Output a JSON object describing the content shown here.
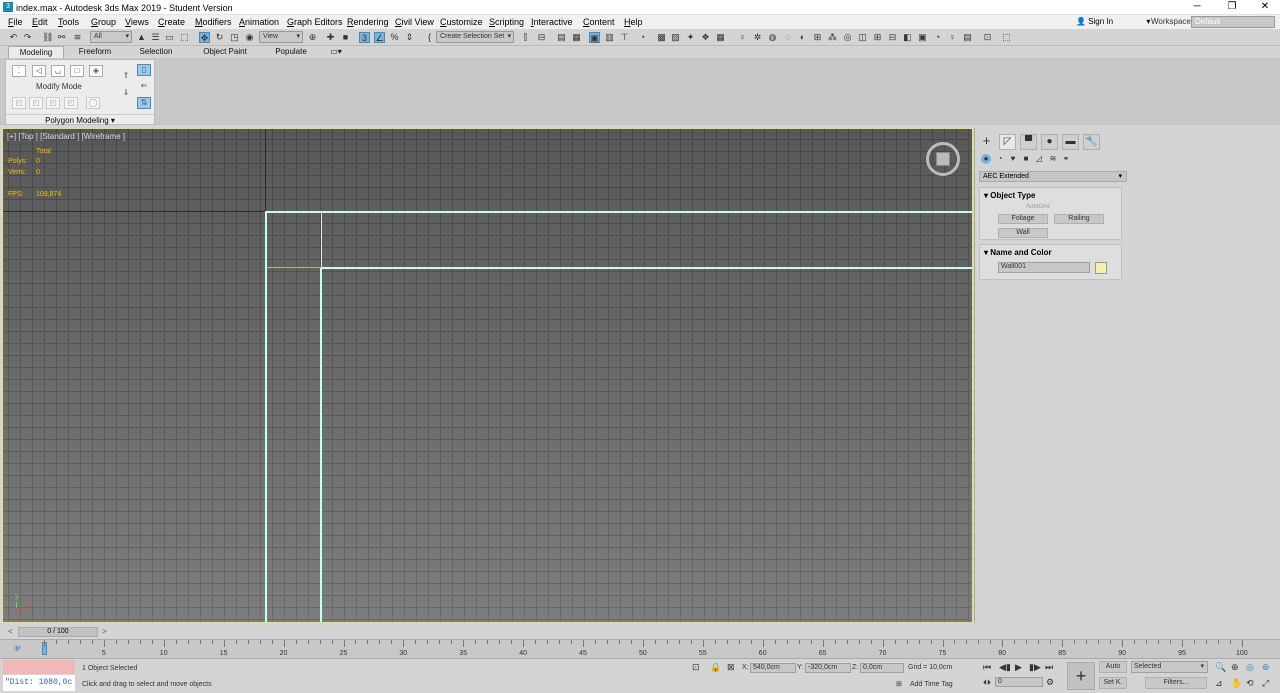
{
  "window": {
    "title": "index.max - Autodesk 3ds Max 2019 - Student Version"
  },
  "menu": [
    "File",
    "Edit",
    "Tools",
    "Group",
    "Views",
    "Create",
    "Modifiers",
    "Animation",
    "Graph Editors",
    "Rendering",
    "Civil View",
    "Customize",
    "Scripting",
    "Interactive",
    "Content",
    "Help"
  ],
  "account": {
    "signin": "Sign In",
    "workspaces_label": "Workspaces:",
    "workspace": "Default"
  },
  "toolbar": {
    "filter": "All",
    "refcoord": "View",
    "selset": "Create Selection Set"
  },
  "ribbon": {
    "tabs": [
      "Modeling",
      "Freeform",
      "Selection",
      "Object Paint",
      "Populate"
    ],
    "mode_label": "Modify Mode",
    "panel_label": "Polygon Modeling"
  },
  "viewport": {
    "label": "[+] [Top ] [Standard ] [Wireframe ]",
    "stats": {
      "total": "Total",
      "polys_label": "Polys:",
      "polys": "0",
      "verts_label": "Verts:",
      "verts": "0",
      "fps_label": "FPS:",
      "fps": "109,874"
    }
  },
  "command_panel": {
    "category": "AEC Extended",
    "object_type": {
      "header": "Object Type",
      "autogrid": "AutoGrid",
      "buttons": [
        "Foliage",
        "Railing",
        "Wall"
      ]
    },
    "name_color": {
      "header": "Name and Color",
      "name": "Wall001",
      "color": "#f2f2a8"
    }
  },
  "timeline": {
    "frame": "0 / 100",
    "ticks": [
      "5",
      "10",
      "15",
      "20",
      "25",
      "30",
      "35",
      "40",
      "45",
      "50",
      "55",
      "60",
      "65",
      "70",
      "75",
      "80",
      "85",
      "90",
      "95",
      "100"
    ]
  },
  "status": {
    "maxscript": "\"Dist: 1080,0c",
    "selected": "1 Object Selected",
    "prompt": "Click and drag to select and move objects",
    "x_label": "X:",
    "x": "540,0cm",
    "y_label": "Y:",
    "y": "-320,0cm",
    "z_label": "Z:",
    "z": "0,0cm",
    "grid": "Grid = 10,0cm",
    "add_time_tag": "Add Time Tag",
    "auto": "Auto",
    "setkey": "Set K.",
    "key_filter": "Selected",
    "filters": "Filters...",
    "frame_field": "0"
  }
}
